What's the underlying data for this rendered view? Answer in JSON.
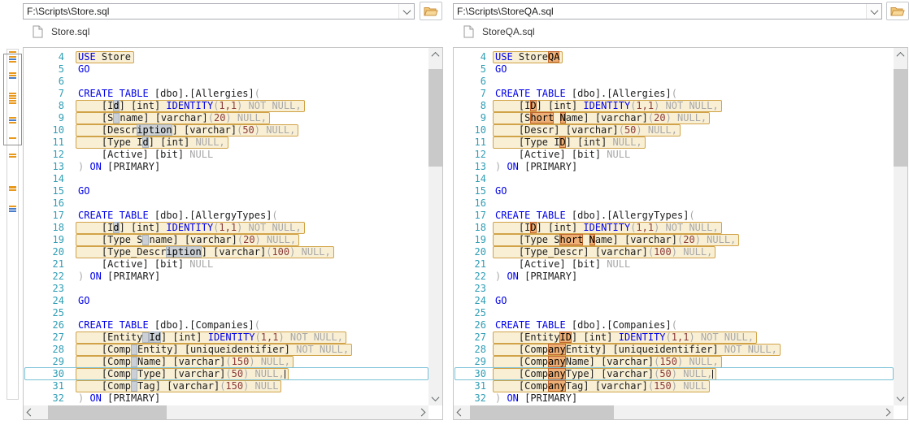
{
  "left": {
    "path": "F:\\Scripts\\Store.sql",
    "tab": "Store.sql",
    "lines": [
      {
        "n": 4,
        "d": true,
        "s": [
          [
            "USE ",
            "kw"
          ],
          [
            "Store",
            "id"
          ]
        ]
      },
      {
        "n": 5,
        "s": [
          [
            "GO",
            "kw"
          ]
        ]
      },
      {
        "n": 6,
        "s": []
      },
      {
        "n": 7,
        "s": [
          [
            "CREATE TABLE ",
            "kw"
          ],
          [
            "[dbo].[Allergies]",
            "id"
          ],
          [
            "(",
            "gy"
          ]
        ]
      },
      {
        "n": 8,
        "d": true,
        "s": [
          [
            "    [I",
            "id"
          ],
          [
            "d",
            "ch"
          ],
          [
            "] [int] ",
            "id"
          ],
          [
            "IDENTITY",
            "kw"
          ],
          [
            "(",
            "gy"
          ],
          [
            "1,1",
            "nm"
          ],
          [
            ") NOT NULL,",
            "gy"
          ]
        ]
      },
      {
        "n": 9,
        "d": true,
        "s": [
          [
            "    [S",
            "id"
          ],
          [
            "",
            "gap"
          ],
          [
            "name] [varchar]",
            "id"
          ],
          [
            "(",
            "gy"
          ],
          [
            "20",
            "nm"
          ],
          [
            ") NULL,",
            "gy"
          ]
        ]
      },
      {
        "n": 10,
        "d": true,
        "s": [
          [
            "    [Descr",
            "id"
          ],
          [
            "iption",
            "ch"
          ],
          [
            "] [varchar]",
            "id"
          ],
          [
            "(",
            "gy"
          ],
          [
            "50",
            "nm"
          ],
          [
            ") NULL,",
            "gy"
          ]
        ]
      },
      {
        "n": 11,
        "d": true,
        "s": [
          [
            "    [Type I",
            "id"
          ],
          [
            "d",
            "ch"
          ],
          [
            "] [int] ",
            "id"
          ],
          [
            "NULL,",
            "gy"
          ]
        ]
      },
      {
        "n": 12,
        "s": [
          [
            "    [Active] [bit] ",
            "id"
          ],
          [
            "NULL",
            "gy"
          ]
        ]
      },
      {
        "n": 13,
        "s": [
          [
            ") ",
            "gy"
          ],
          [
            "ON ",
            "kw"
          ],
          [
            "[PRIMARY]",
            "id"
          ]
        ]
      },
      {
        "n": 14,
        "s": []
      },
      {
        "n": 15,
        "s": [
          [
            "GO",
            "kw"
          ]
        ]
      },
      {
        "n": 16,
        "s": []
      },
      {
        "n": 17,
        "s": [
          [
            "CREATE TABLE ",
            "kw"
          ],
          [
            "[dbo].[AllergyTypes]",
            "id"
          ],
          [
            "(",
            "gy"
          ]
        ]
      },
      {
        "n": 18,
        "d": true,
        "s": [
          [
            "    [I",
            "id"
          ],
          [
            "d",
            "ch"
          ],
          [
            "] [int] ",
            "id"
          ],
          [
            "IDENTITY",
            "kw"
          ],
          [
            "(",
            "gy"
          ],
          [
            "1,1",
            "nm"
          ],
          [
            ") NOT NULL,",
            "gy"
          ]
        ]
      },
      {
        "n": 19,
        "d": true,
        "s": [
          [
            "    [Type S",
            "id"
          ],
          [
            "",
            "gap"
          ],
          [
            "name] [varchar]",
            "id"
          ],
          [
            "(",
            "gy"
          ],
          [
            "20",
            "nm"
          ],
          [
            ") NULL,",
            "gy"
          ]
        ]
      },
      {
        "n": 20,
        "d": true,
        "s": [
          [
            "    [Type_Descr",
            "id"
          ],
          [
            "iption",
            "ch"
          ],
          [
            "] [varchar]",
            "id"
          ],
          [
            "(",
            "gy"
          ],
          [
            "100",
            "nm"
          ],
          [
            ") NULL,",
            "gy"
          ]
        ]
      },
      {
        "n": 21,
        "s": [
          [
            "    [Active] [bit] ",
            "id"
          ],
          [
            "NULL",
            "gy"
          ]
        ]
      },
      {
        "n": 22,
        "s": [
          [
            ") ",
            "gy"
          ],
          [
            "ON ",
            "kw"
          ],
          [
            "[PRIMARY]",
            "id"
          ]
        ]
      },
      {
        "n": 23,
        "s": []
      },
      {
        "n": 24,
        "s": [
          [
            "GO",
            "kw"
          ]
        ]
      },
      {
        "n": 25,
        "s": []
      },
      {
        "n": 26,
        "s": [
          [
            "CREATE TABLE ",
            "kw"
          ],
          [
            "[dbo].[Companies]",
            "id"
          ],
          [
            "(",
            "gy"
          ]
        ]
      },
      {
        "n": 27,
        "d": true,
        "s": [
          [
            "    [Entity",
            "id"
          ],
          [
            "",
            "gap"
          ],
          [
            "Id",
            "ch"
          ],
          [
            "] [int] ",
            "id"
          ],
          [
            "IDENTITY",
            "kw"
          ],
          [
            "(",
            "gy"
          ],
          [
            "1,1",
            "nm"
          ],
          [
            ") NOT NULL,",
            "gy"
          ]
        ]
      },
      {
        "n": 28,
        "d": true,
        "s": [
          [
            "    [Comp",
            "id"
          ],
          [
            "",
            "gap"
          ],
          [
            "Entity] [uniqueidentifier] ",
            "id"
          ],
          [
            "NOT NULL,",
            "gy"
          ]
        ]
      },
      {
        "n": 29,
        "d": true,
        "s": [
          [
            "    [Comp",
            "id"
          ],
          [
            "",
            "gap"
          ],
          [
            "Name] [varchar]",
            "id"
          ],
          [
            "(",
            "gy"
          ],
          [
            "150",
            "nm"
          ],
          [
            ") NULL,",
            "gy"
          ]
        ]
      },
      {
        "n": 30,
        "d": true,
        "a": true,
        "s": [
          [
            "    [Comp",
            "id"
          ],
          [
            "",
            "gap"
          ],
          [
            "Type] [varchar]",
            "id"
          ],
          [
            "(",
            "gy"
          ],
          [
            "50",
            "nm"
          ],
          [
            ") NULL,",
            "gy"
          ],
          [
            "",
            "caret"
          ]
        ]
      },
      {
        "n": 31,
        "d": true,
        "s": [
          [
            "    [Comp",
            "id"
          ],
          [
            "",
            "gap"
          ],
          [
            "Tag] [varchar]",
            "id"
          ],
          [
            "(",
            "gy"
          ],
          [
            "150",
            "nm"
          ],
          [
            ") NULL",
            "gy"
          ]
        ]
      },
      {
        "n": 32,
        "s": [
          [
            ") ",
            "gy"
          ],
          [
            "ON ",
            "kw"
          ],
          [
            "[PRIMARY]",
            "id"
          ]
        ]
      }
    ]
  },
  "right": {
    "path": "F:\\Scripts\\StoreQA.sql",
    "tab": "StoreQA.sql",
    "lines": [
      {
        "n": 4,
        "d": true,
        "s": [
          [
            "USE ",
            "kw"
          ],
          [
            "Store",
            "id"
          ],
          [
            "QA",
            "ch"
          ]
        ]
      },
      {
        "n": 5,
        "s": [
          [
            "GO",
            "kw"
          ]
        ]
      },
      {
        "n": 6,
        "s": []
      },
      {
        "n": 7,
        "s": [
          [
            "CREATE TABLE ",
            "kw"
          ],
          [
            "[dbo].[Allergies]",
            "id"
          ],
          [
            "(",
            "gy"
          ]
        ]
      },
      {
        "n": 8,
        "d": true,
        "s": [
          [
            "    [I",
            "id"
          ],
          [
            "D",
            "ch"
          ],
          [
            "] [int] ",
            "id"
          ],
          [
            "IDENTITY",
            "kw"
          ],
          [
            "(",
            "gy"
          ],
          [
            "1,1",
            "nm"
          ],
          [
            ") NOT NULL,",
            "gy"
          ]
        ]
      },
      {
        "n": 9,
        "d": true,
        "s": [
          [
            "    [S",
            "id"
          ],
          [
            "hort",
            "ch"
          ],
          [
            " ",
            "id"
          ],
          [
            "N",
            "ch"
          ],
          [
            "ame] [varchar]",
            "id"
          ],
          [
            "(",
            "gy"
          ],
          [
            "20",
            "nm"
          ],
          [
            ") NULL,",
            "gy"
          ]
        ]
      },
      {
        "n": 10,
        "d": true,
        "s": [
          [
            "    [Descr] [varchar]",
            "id"
          ],
          [
            "(",
            "gy"
          ],
          [
            "50",
            "nm"
          ],
          [
            ") NULL,",
            "gy"
          ]
        ]
      },
      {
        "n": 11,
        "d": true,
        "s": [
          [
            "    [Type I",
            "id"
          ],
          [
            "D",
            "ch"
          ],
          [
            "] [int] ",
            "id"
          ],
          [
            "NULL,",
            "gy"
          ]
        ]
      },
      {
        "n": 12,
        "s": [
          [
            "    [Active] [bit] ",
            "id"
          ],
          [
            "NULL",
            "gy"
          ]
        ]
      },
      {
        "n": 13,
        "s": [
          [
            ") ",
            "gy"
          ],
          [
            "ON ",
            "kw"
          ],
          [
            "[PRIMARY]",
            "id"
          ]
        ]
      },
      {
        "n": 14,
        "s": []
      },
      {
        "n": 15,
        "s": [
          [
            "GO",
            "kw"
          ]
        ]
      },
      {
        "n": 16,
        "s": []
      },
      {
        "n": 17,
        "s": [
          [
            "CREATE TABLE ",
            "kw"
          ],
          [
            "[dbo].[AllergyTypes]",
            "id"
          ],
          [
            "(",
            "gy"
          ]
        ]
      },
      {
        "n": 18,
        "d": true,
        "s": [
          [
            "    [I",
            "id"
          ],
          [
            "D",
            "ch"
          ],
          [
            "] [int] ",
            "id"
          ],
          [
            "IDENTITY",
            "kw"
          ],
          [
            "(",
            "gy"
          ],
          [
            "1,1",
            "nm"
          ],
          [
            ") NOT NULL,",
            "gy"
          ]
        ]
      },
      {
        "n": 19,
        "d": true,
        "s": [
          [
            "    [Type S",
            "id"
          ],
          [
            "hort",
            "ch"
          ],
          [
            " ",
            "id"
          ],
          [
            "N",
            "ch"
          ],
          [
            "ame] [varchar]",
            "id"
          ],
          [
            "(",
            "gy"
          ],
          [
            "20",
            "nm"
          ],
          [
            ") NULL,",
            "gy"
          ]
        ]
      },
      {
        "n": 20,
        "d": true,
        "s": [
          [
            "    [Type_Descr] [varchar]",
            "id"
          ],
          [
            "(",
            "gy"
          ],
          [
            "100",
            "nm"
          ],
          [
            ") NULL,",
            "gy"
          ]
        ]
      },
      {
        "n": 21,
        "s": [
          [
            "    [Active] [bit] ",
            "id"
          ],
          [
            "NULL",
            "gy"
          ]
        ]
      },
      {
        "n": 22,
        "s": [
          [
            ") ",
            "gy"
          ],
          [
            "ON ",
            "kw"
          ],
          [
            "[PRIMARY]",
            "id"
          ]
        ]
      },
      {
        "n": 23,
        "s": []
      },
      {
        "n": 24,
        "s": [
          [
            "GO",
            "kw"
          ]
        ]
      },
      {
        "n": 25,
        "s": []
      },
      {
        "n": 26,
        "s": [
          [
            "CREATE TABLE ",
            "kw"
          ],
          [
            "[dbo].[Companies]",
            "id"
          ],
          [
            "(",
            "gy"
          ]
        ]
      },
      {
        "n": 27,
        "d": true,
        "s": [
          [
            "    [Entity",
            "id"
          ],
          [
            "ID",
            "ch"
          ],
          [
            "] [int] ",
            "id"
          ],
          [
            "IDENTITY",
            "kw"
          ],
          [
            "(",
            "gy"
          ],
          [
            "1,1",
            "nm"
          ],
          [
            ") NOT NULL,",
            "gy"
          ]
        ]
      },
      {
        "n": 28,
        "d": true,
        "s": [
          [
            "    [Comp",
            "id"
          ],
          [
            "any",
            "ch"
          ],
          [
            "Entity] [uniqueidentifier] ",
            "id"
          ],
          [
            "NOT NULL,",
            "gy"
          ]
        ]
      },
      {
        "n": 29,
        "d": true,
        "s": [
          [
            "    [Comp",
            "id"
          ],
          [
            "any",
            "ch"
          ],
          [
            "Name] [varchar]",
            "id"
          ],
          [
            "(",
            "gy"
          ],
          [
            "150",
            "nm"
          ],
          [
            ") NULL,",
            "gy"
          ]
        ]
      },
      {
        "n": 30,
        "d": true,
        "a": true,
        "s": [
          [
            "    [Comp",
            "id"
          ],
          [
            "any",
            "ch"
          ],
          [
            "Type] [varchar]",
            "id"
          ],
          [
            "(",
            "gy"
          ],
          [
            "50",
            "nm"
          ],
          [
            ") NULL,",
            "gy"
          ],
          [
            "",
            "caret"
          ]
        ]
      },
      {
        "n": 31,
        "d": true,
        "s": [
          [
            "    [Comp",
            "id"
          ],
          [
            "any",
            "ch"
          ],
          [
            "Tag] [varchar]",
            "id"
          ],
          [
            "(",
            "gy"
          ],
          [
            "150",
            "nm"
          ],
          [
            ") NULL",
            "gy"
          ]
        ]
      },
      {
        "n": 32,
        "s": [
          [
            ") ",
            "gy"
          ],
          [
            "ON ",
            "kw"
          ],
          [
            "[PRIMARY]",
            "id"
          ]
        ]
      }
    ]
  },
  "overview": {
    "mark_colors": {
      "o": "#E8991C",
      "b": "#4A7DC9"
    },
    "marks": [
      {
        "t": 2,
        "c": "o"
      },
      {
        "t": 8,
        "c": "o"
      },
      {
        "t": 11,
        "c": "b"
      },
      {
        "t": 14,
        "c": "o"
      },
      {
        "t": 28,
        "c": "o"
      },
      {
        "t": 31,
        "c": "o"
      },
      {
        "t": 34,
        "c": "b"
      },
      {
        "t": 53,
        "c": "o"
      },
      {
        "t": 56,
        "c": "o"
      },
      {
        "t": 59,
        "c": "o"
      },
      {
        "t": 62,
        "c": "o"
      },
      {
        "t": 65,
        "c": "o"
      },
      {
        "t": 83,
        "c": "o"
      },
      {
        "t": 86,
        "c": "b"
      },
      {
        "t": 89,
        "c": "o"
      },
      {
        "t": 108,
        "c": "o"
      },
      {
        "t": 128,
        "c": "o"
      },
      {
        "t": 131,
        "c": "o"
      },
      {
        "t": 168,
        "c": "o",
        "h": 3
      },
      {
        "t": 172,
        "c": "o"
      },
      {
        "t": 192,
        "c": "o"
      },
      {
        "t": 195,
        "c": "b"
      },
      {
        "t": 198,
        "c": "b"
      }
    ]
  },
  "colors": {
    "diff_line_bg": "#F8EFD5",
    "diff_line_border": "#D1A348",
    "changed_text_left_bg": "#CAD0D6",
    "changed_text_right_bg": "#EEAF76",
    "keyword_blue": "#0000E8",
    "muted_gray": "#A8A8A8",
    "number_maroon": "#8B3A3A",
    "line_number_teal": "#2F9DB4",
    "active_line_border": "#7AC1D7",
    "folder_icon_fill": "#F2C878"
  },
  "icons": {
    "combo_dropdown": "chevron-down-icon",
    "browse": "folder-open-icon",
    "tab_file": "document-icon",
    "scroll_up": "chevron-up-icon",
    "scroll_down": "chevron-down-icon",
    "scroll_left": "chevron-left-icon",
    "scroll_right": "chevron-right-icon"
  }
}
